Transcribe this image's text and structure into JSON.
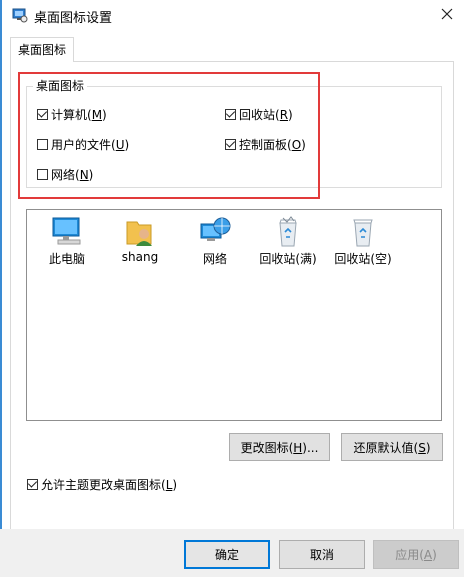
{
  "window": {
    "title": "桌面图标设置",
    "close_icon": "close-icon"
  },
  "tabs": [
    {
      "label": "桌面图标"
    }
  ],
  "desktop_icons_group": {
    "legend": "桌面图标",
    "checkboxes": [
      {
        "pre": "计算机(",
        "key": "M",
        "post": ")",
        "checked": true
      },
      {
        "pre": "回收站(",
        "key": "R",
        "post": ")",
        "checked": true
      },
      {
        "pre": "用户的文件(",
        "key": "U",
        "post": ")",
        "checked": false
      },
      {
        "pre": "控制面板(",
        "key": "O",
        "post": ")",
        "checked": true
      },
      {
        "pre": "网络(",
        "key": "N",
        "post": ")",
        "checked": false
      }
    ]
  },
  "icon_list": [
    {
      "label": "此电脑",
      "icon": "computer-icon"
    },
    {
      "label": "shang",
      "icon": "user-folder-icon"
    },
    {
      "label": "网络",
      "icon": "network-icon"
    },
    {
      "label": "回收站(满)",
      "icon": "recycle-bin-full-icon"
    },
    {
      "label": "回收站(空)",
      "icon": "recycle-bin-empty-icon"
    }
  ],
  "buttons": {
    "change_icon": {
      "pre": "更改图标(",
      "key": "H",
      "post": ")..."
    },
    "restore_default": {
      "pre": "还原默认值(",
      "key": "S",
      "post": ")"
    },
    "ok": "确定",
    "cancel": "取消",
    "apply": {
      "pre": "应用(",
      "key": "A",
      "post": ")"
    }
  },
  "allow_themes": {
    "pre": "允许主题更改桌面图标(",
    "key": "L",
    "post": ")",
    "checked": true
  },
  "colors": {
    "highlight": "#e23a3a",
    "accent": "#0078d7"
  }
}
